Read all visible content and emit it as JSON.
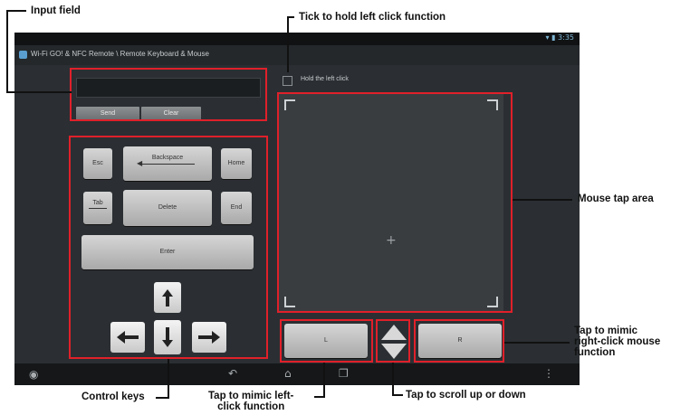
{
  "annotations": {
    "input_field": "Input field",
    "hold_left_click": "Tick to hold left click function",
    "mouse_tap_area": "Mouse tap area",
    "right_click": "Tap to mimic\nright-click mouse\nfunction",
    "control_keys": "Control keys",
    "left_click": "Tap to mimic left-\nclick function",
    "scroll": "Tap to scroll up or down"
  },
  "app": {
    "title": "Wi-Fi GO! & NFC Remote \\ Remote Keyboard & Mouse",
    "status": "▾ ▮ 3:35"
  },
  "input": {
    "value": "",
    "send_label": "Send",
    "clear_label": "Clear"
  },
  "keys": {
    "esc": "Esc",
    "backspace": "Backspace",
    "home": "Home",
    "tab": "Tab",
    "delete": "Delete",
    "end": "End",
    "enter": "Enter"
  },
  "mouse": {
    "hold_label": "Hold the left click",
    "hold_checked": false,
    "left_button": "L",
    "right_button": "R"
  },
  "colors": {
    "highlight": "#e0202a",
    "screen": "#2b2f33",
    "key": "#c4c4c4"
  }
}
